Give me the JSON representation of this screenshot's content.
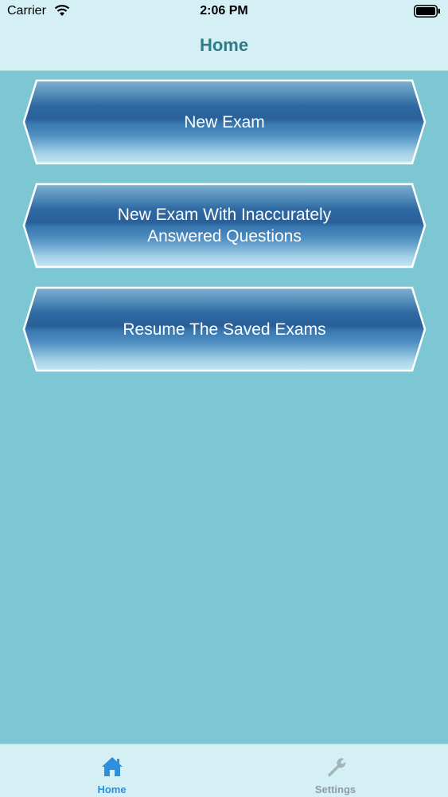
{
  "status_bar": {
    "carrier": "Carrier",
    "time": "2:06 PM",
    "wifi_icon": "wifi-icon",
    "battery_icon": "battery-icon"
  },
  "nav": {
    "title": "Home"
  },
  "buttons": [
    {
      "label": "New Exam"
    },
    {
      "label": "New Exam With Inaccurately\nAnswered Questions"
    },
    {
      "label": "Resume The Saved Exams"
    }
  ],
  "tabs": [
    {
      "label": "Home",
      "icon": "house-icon",
      "selected": true
    },
    {
      "label": "Settings",
      "icon": "wrench-icon",
      "selected": false
    }
  ],
  "colors": {
    "background": "#7cc7d3",
    "bar_background": "#d4f0f4",
    "title": "#2f7c84",
    "button_blue": "#2e6aa3",
    "tab_active": "#2f8fdc",
    "tab_inactive": "#8e9da2"
  }
}
